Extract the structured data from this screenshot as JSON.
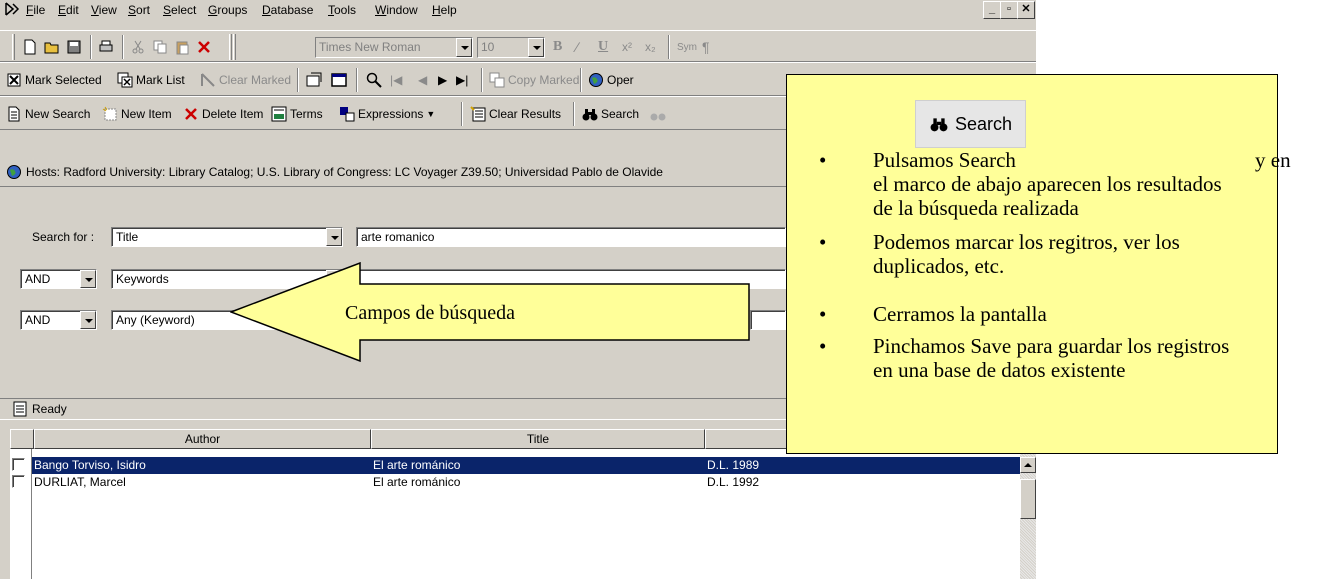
{
  "menubar": {
    "items": [
      "File",
      "Edit",
      "View",
      "Sort",
      "Select",
      "Groups",
      "Database",
      "Tools",
      "Window",
      "Help"
    ],
    "controls": [
      "_",
      "▫",
      "✕"
    ]
  },
  "format_toolbar": {
    "font": "Times New Roman",
    "size": "10"
  },
  "marks_toolbar": {
    "mark_selected": "Mark Selected",
    "mark_list": "Mark List",
    "clear_marked": "Clear Marked",
    "copy_marked": "Copy Marked",
    "open": "Oper"
  },
  "search_toolbar": {
    "new_search": "New Search",
    "new_item": "New Item",
    "delete_item": "Delete Item",
    "terms": "Terms",
    "expressions": "Expressions",
    "clear_results": "Clear Results",
    "search": "Search"
  },
  "hosts": {
    "text": "Hosts:  Radford University: Library Catalog; U.S. Library of Congress: LC Voyager Z39.50; Universidad Pablo de Olavide"
  },
  "search_form": {
    "search_for_label": "Search for :",
    "rows": [
      {
        "op": "",
        "field": "Title",
        "value": "arte romanico"
      },
      {
        "op": "AND",
        "field": "Keywords",
        "value": ""
      },
      {
        "op": "AND",
        "field": "Any (Keyword)",
        "value": ""
      }
    ]
  },
  "status": {
    "text": "Ready"
  },
  "results": {
    "columns": [
      "Author",
      "Title",
      ""
    ],
    "rows": [
      {
        "author": "Bango Torviso, Isidro",
        "title": "El arte románico",
        "date": "D.L. 1989",
        "selected": true
      },
      {
        "author": "DURLIAT, Marcel",
        "title": "El arte románico",
        "date": "D.L. 1992",
        "selected": false
      }
    ]
  },
  "callout_arrow": {
    "text": "Campos de búsqueda"
  },
  "note": {
    "search_button_label": "Search",
    "items": [
      "Pulsamos Search",
      "y en",
      "el marco de abajo aparecen los resultados de la búsqueda realizada",
      "Podemos marcar los regitros, ver los duplicados, etc.",
      "Cerramos la pantalla",
      "Pinchamos Save para guardar los registros en una base de datos existente"
    ]
  },
  "colors": {
    "selection": "#0a246a",
    "note_bg": "#ffff99",
    "window_face": "#d4d0c8"
  }
}
